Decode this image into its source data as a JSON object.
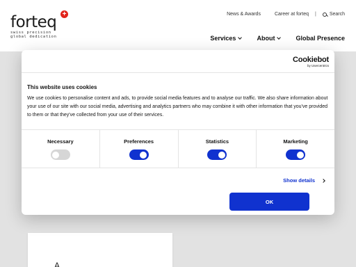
{
  "header": {
    "logo": {
      "word": "forteq",
      "tagline_line1": "swiss precision",
      "tagline_line2": "global dedication"
    },
    "topnav": {
      "news": "News & Awards",
      "career": "Career at forteq",
      "separator": "|",
      "search": "Search"
    },
    "mainnav": {
      "services": "Services",
      "about": "About",
      "global": "Global Presence"
    }
  },
  "background": {
    "card_mark": "A"
  },
  "dialog": {
    "brand": {
      "name": "Cookiebot",
      "sub": "by Usercentrics"
    },
    "title": "This website uses cookies",
    "body": "We use cookies to personalise content and ads, to provide social media features and to analyse our traffic. We also share information about your use of our site with our social media, advertising and analytics partners who may combine it with other information that you've provided to them or that they've collected from your use of their services.",
    "toggles": [
      {
        "label": "Necessary",
        "state": "off-disabled"
      },
      {
        "label": "Preferences",
        "state": "on"
      },
      {
        "label": "Statistics",
        "state": "on"
      },
      {
        "label": "Marketing",
        "state": "on"
      }
    ],
    "show_details": "Show details",
    "ok_label": "OK"
  },
  "colors": {
    "accent": "#1032cf",
    "brand_red": "#e2231a"
  }
}
